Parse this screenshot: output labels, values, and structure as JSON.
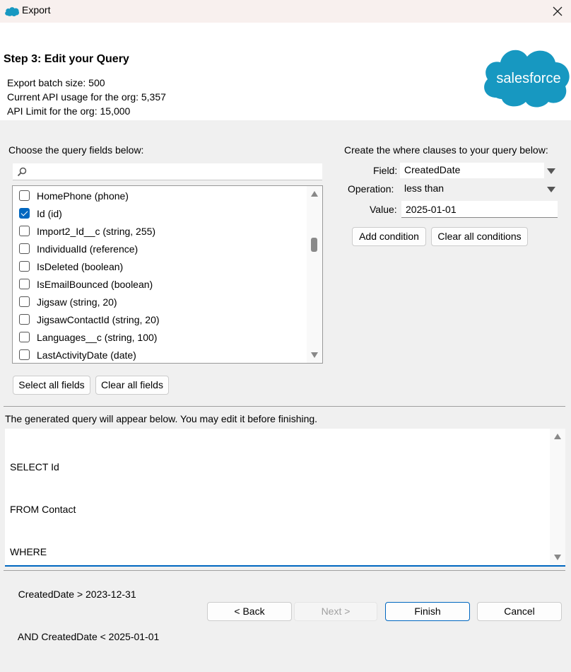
{
  "window": {
    "title": "Export",
    "app_icon": "salesforce-cloud-icon",
    "close_icon": "close-icon"
  },
  "header": {
    "step_title": "Step 3: Edit your Query",
    "info": [
      "Export batch size: 500",
      "Current API usage for the org: 5,357",
      "API Limit for the org: 15,000"
    ],
    "logo_text": "salesforce",
    "brand_color": "#1798c1"
  },
  "fields_panel": {
    "label": "Choose the query fields below:",
    "search_placeholder": "",
    "search_icon": "search-icon",
    "items": [
      {
        "label": "HomePhone (phone)",
        "checked": false
      },
      {
        "label": "Id (id)",
        "checked": true
      },
      {
        "label": "Import2_Id__c (string, 255)",
        "checked": false
      },
      {
        "label": "IndividualId (reference)",
        "checked": false
      },
      {
        "label": "IsDeleted (boolean)",
        "checked": false
      },
      {
        "label": "IsEmailBounced (boolean)",
        "checked": false
      },
      {
        "label": "Jigsaw (string, 20)",
        "checked": false
      },
      {
        "label": "JigsawContactId (string, 20)",
        "checked": false
      },
      {
        "label": "Languages__c (string, 100)",
        "checked": false
      },
      {
        "label": "LastActivityDate (date)",
        "checked": false
      }
    ],
    "select_all_label": "Select all fields",
    "clear_all_label": "Clear all fields"
  },
  "where_panel": {
    "label": "Create the where clauses to your query below:",
    "field_label": "Field:",
    "field_value": "CreatedDate",
    "operation_label": "Operation:",
    "operation_value": "less than",
    "value_label": "Value:",
    "value_value": "2025-01-01",
    "add_condition_label": "Add condition",
    "clear_conditions_label": "Clear all conditions"
  },
  "query_panel": {
    "label": "The generated query will appear below.  You may edit it before finishing.",
    "lines": [
      "SELECT Id",
      "FROM Contact",
      "WHERE",
      "   CreatedDate > 2023-12-31",
      "   AND CreatedDate < 2025-01-01"
    ]
  },
  "footer": {
    "back_label": "< Back",
    "next_label": "Next >",
    "finish_label": "Finish",
    "cancel_label": "Cancel"
  },
  "accent_color": "#0067c0"
}
